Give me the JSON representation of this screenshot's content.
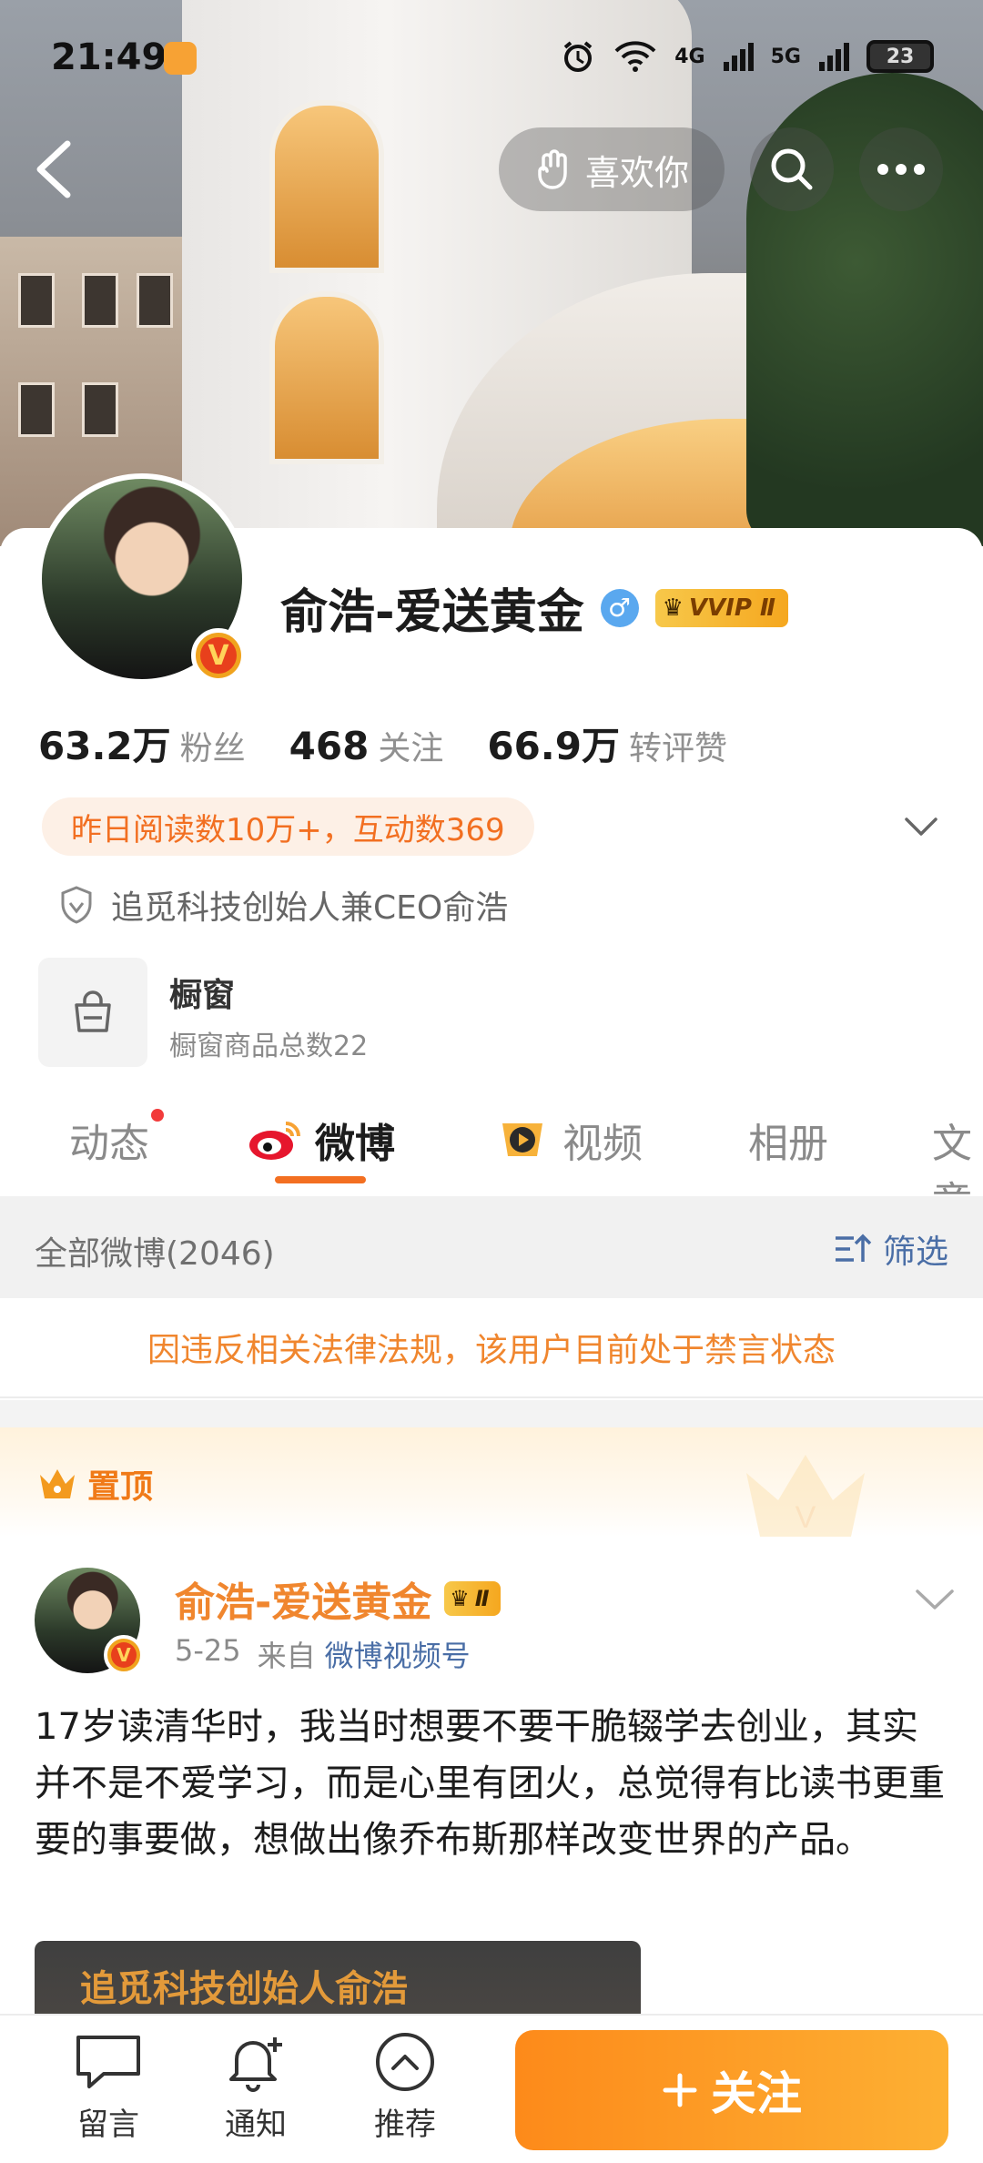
{
  "status_bar": {
    "time": "21:49",
    "network_1": "4G",
    "network_2": "5G",
    "battery": "23"
  },
  "header": {
    "like_label": "喜欢你"
  },
  "profile": {
    "name": "俞浩-爱送黄金",
    "vip_label": "VVIP Ⅱ",
    "stats": [
      {
        "value": "63.2万",
        "label": "粉丝"
      },
      {
        "value": "468",
        "label": "关注"
      },
      {
        "value": "66.9万",
        "label": "转评赞"
      }
    ],
    "read_summary": "昨日阅读数10万+，互动数369",
    "verification": "追觅科技创始人兼CEO俞浩",
    "shop": {
      "title": "橱窗",
      "subtitle": "橱窗商品总数22"
    }
  },
  "tabs": [
    {
      "label": "动态"
    },
    {
      "label": "微博"
    },
    {
      "label": "视频"
    },
    {
      "label": "相册"
    },
    {
      "label": "文章"
    }
  ],
  "feed": {
    "filter_left": "全部微博(2046)",
    "filter_right": "筛选",
    "ban_notice": "因违反相关法律法规，该用户目前处于禁言状态",
    "pinned_label": "置顶"
  },
  "post": {
    "author": "俞浩-爱送黄金",
    "vip_label": "Ⅱ",
    "date": "5-25",
    "from_label": "来自",
    "source": "微博视频号",
    "text": "17岁读清华时，我当时想要不要干脆辍学去创业，其实并不是不爱学习，而是心里有团火，总觉得有比读书更重要的事要做，想做出像乔布斯那样改变世界的产品。",
    "video_caption": "追觅科技创始人俞浩"
  },
  "bottom_bar": {
    "items": [
      {
        "label": "留言"
      },
      {
        "label": "通知"
      },
      {
        "label": "推荐"
      }
    ],
    "follow_label": "关注"
  },
  "colors": {
    "accent": "#f36f21",
    "orange_text": "#f0862e",
    "link_blue": "#4a6ea6",
    "follow_gradient_start": "#fd8a1a",
    "follow_gradient_end": "#fdb033"
  }
}
